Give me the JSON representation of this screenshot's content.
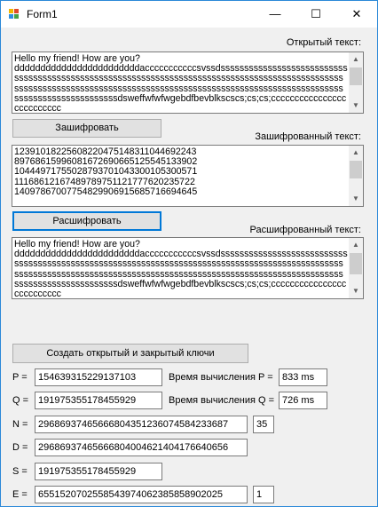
{
  "window": {
    "title": "Form1",
    "minimize_glyph": "—",
    "maximize_glyph": "☐",
    "close_glyph": "✕",
    "icon": "winforms-app-icon"
  },
  "plain": {
    "label": "Открытый текст:",
    "text": "Hello my friend! How are you?\nddddddddddddddddddddddddacccccccccccsvssdsssssssssssssssssssssssssssssssssssssssssssssssssssssssssssssssssssssssssssssssssssssssssssssssssssssssssssssssssssssssssssssssssssssssssssssssssssssssssssssssssssssssssssssssssssssssssssssdsweffwfwfwgebdfbevblkscscs;cs;cs;cccccccccccccccccccccccccc"
  },
  "encrypt_button": "Зашифровать",
  "cipher": {
    "label": "Зашифрованный текст:",
    "lines": [
      "12391018225608220475148311044692243",
      "89768615996081672690665125545133902",
      "10444971755028793701043300105300571",
      "11168612167489789751121777620235722",
      "14097867007754829906915685716694645"
    ]
  },
  "decrypt_button": "Расшифровать",
  "decrypted": {
    "label": "Расшифрованный текст:",
    "text": "Hello my friend! How are you?\nddddddddddddddddddddddddacccccccccccsvssdsssssssssssssssssssssssssssssssssssssssssssssssssssssssssssssssssssssssssssssssssssssssssssssssssssssssssssssssssssssssssssssssssssssssssssssssssssssssssssssssssssssssssssssssssssssssssssssdsweffwfwfwgebdfbevblkscscs;cs;cs;cccccccccccccccccccccccccc"
  },
  "keys_button": "Создать открытый и закрытый ключи",
  "params": {
    "p_label": "P =",
    "p_value": "154639315229137103",
    "q_label": "Q =",
    "q_value": "191975355178455929",
    "n_label": "N =",
    "n_value": "296869374656668043512360745842336 87",
    "n_side": "35",
    "d_label": "D =",
    "d_value": "29686937465666804004621404176640656",
    "s_label": "S =",
    "s_value": "191975355178455929",
    "e_label": "E =",
    "e_value": "65515207025585439740623858589020 25",
    "e_side": "1",
    "time_p_label": "Время вычисления P =",
    "time_p_value": "833 ms",
    "time_q_label": "Время вычисления Q =",
    "time_q_value": "726 ms"
  }
}
